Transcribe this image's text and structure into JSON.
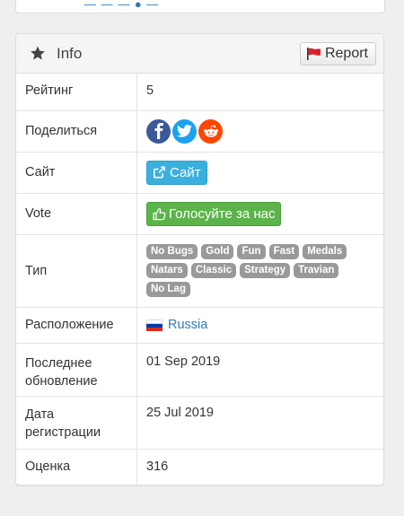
{
  "panel": {
    "title": "Info",
    "report_label": "Report"
  },
  "rows": {
    "rating": {
      "label": "Рейтинг",
      "value": "5"
    },
    "share": {
      "label": "Поделиться"
    },
    "site": {
      "label": "Сайт",
      "button_label": "Сайт"
    },
    "vote": {
      "label": "Vote",
      "button_label": "Голосуйте за нас"
    },
    "type": {
      "label": "Тип",
      "tags": [
        "No Bugs",
        "Gold",
        "Fun",
        "Fast",
        "Medals",
        "Natars",
        "Classic",
        "Strategy",
        "Travian",
        "No Lag"
      ]
    },
    "location": {
      "label": "Расположение",
      "value": "Russia"
    },
    "updated": {
      "label": "Последнее обновление",
      "value": "01 Sep 2019"
    },
    "registered": {
      "label": "Дата регистрации",
      "value": "25 Jul 2019"
    },
    "score": {
      "label": "Оценка",
      "value": "316"
    }
  },
  "icons": {
    "heading": "star-icon",
    "report": "flag-icon",
    "facebook": "facebook-icon",
    "twitter": "twitter-icon",
    "reddit": "reddit-icon",
    "site": "external-link-icon",
    "vote": "thumbs-up-icon",
    "location": "russia-flag-icon"
  },
  "colors": {
    "facebook": "#3b5998",
    "twitter": "#1da1f2",
    "reddit": "#ff4500",
    "site_button": "#3ab0de",
    "vote_button": "#5cb34a",
    "tag": "#999999",
    "link": "#337ab7",
    "report_flag": "#d9232a"
  }
}
